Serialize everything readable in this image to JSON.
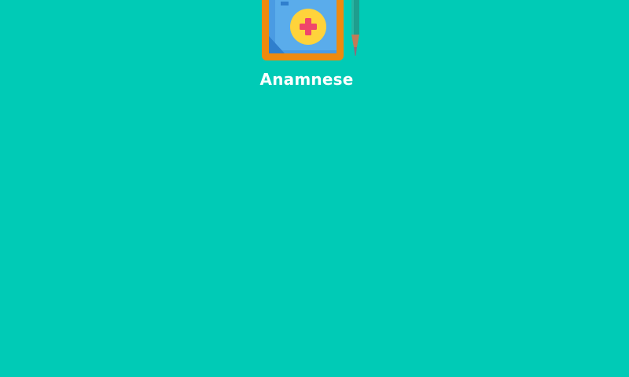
{
  "screen": {
    "background_color": "#00CBB6"
  },
  "app": {
    "label": "Anamnese",
    "icon": "medical-record-clipboard-icon",
    "colors": {
      "frame": "#EE8A0E",
      "sheet": "#4A9BE3",
      "badge": "#FFD33B",
      "cross": "#F0456B",
      "pencil": "#1E9E8E"
    }
  }
}
